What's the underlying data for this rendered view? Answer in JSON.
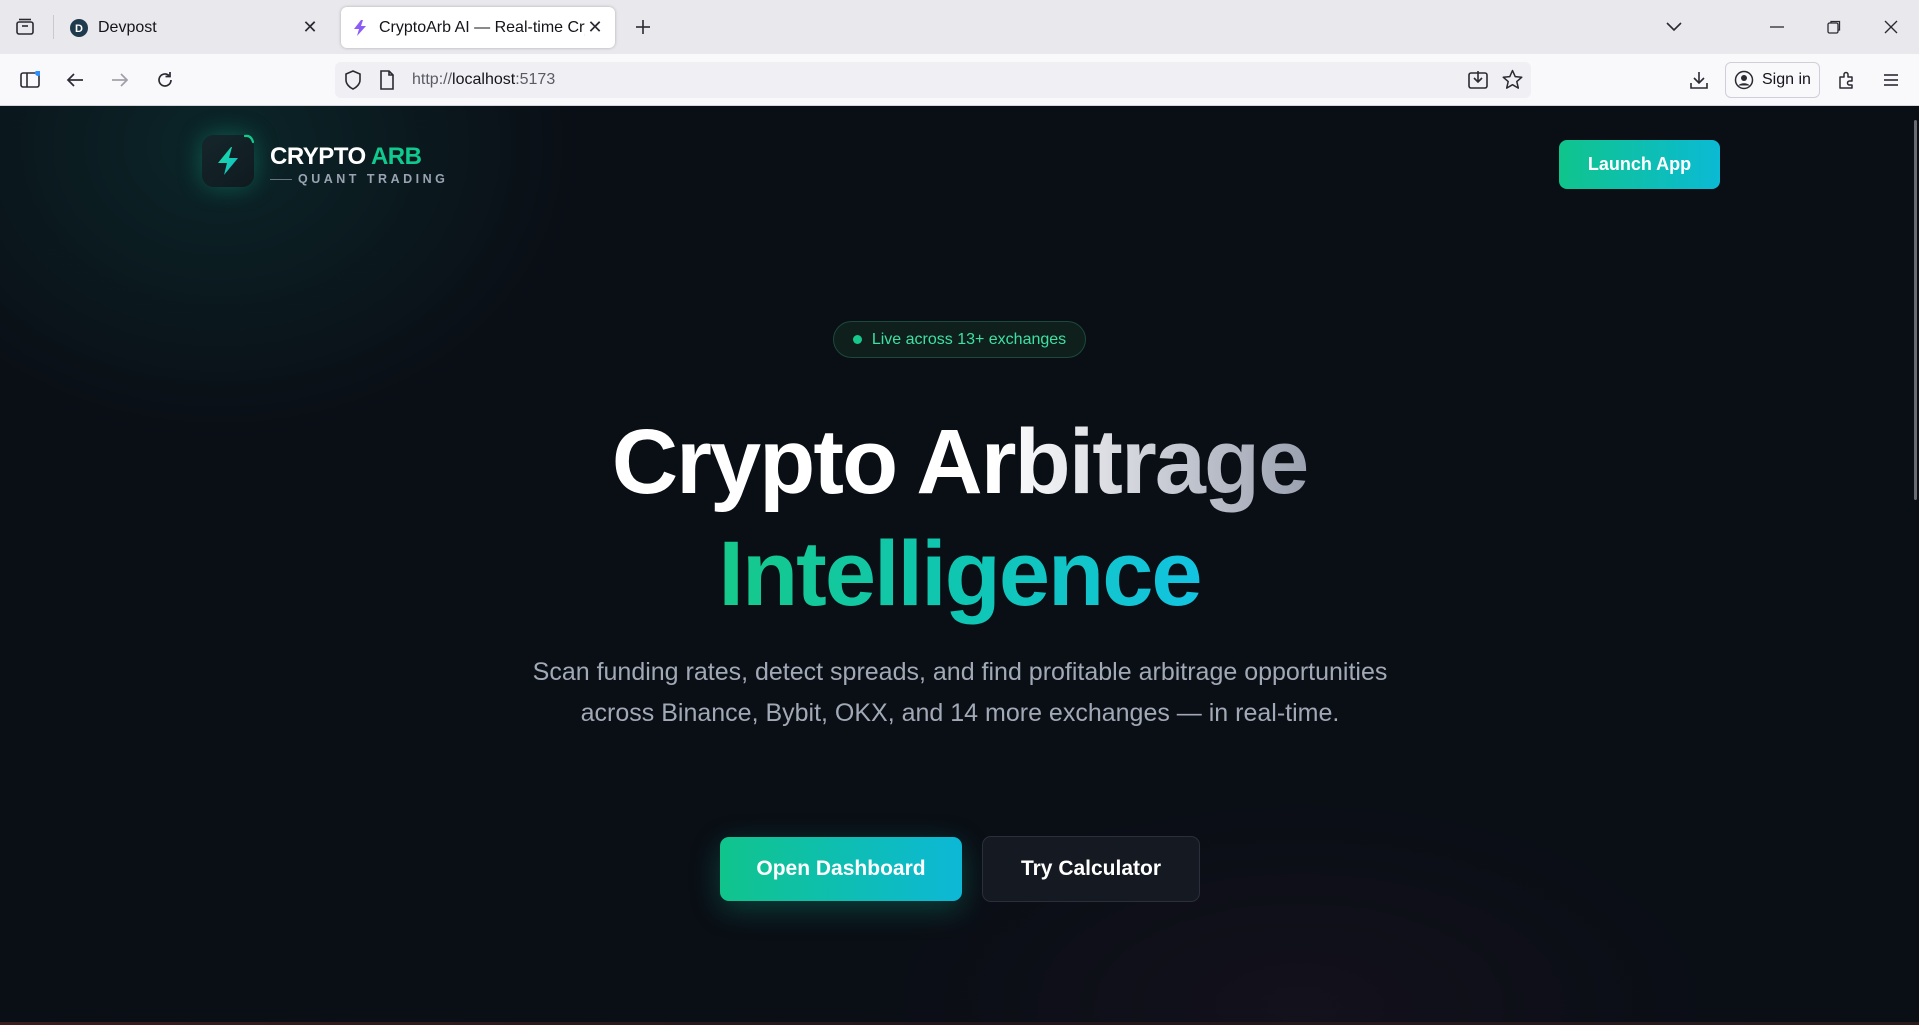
{
  "browser": {
    "tabs": [
      {
        "title": "Devpost",
        "active": false
      },
      {
        "title": "CryptoArb AI — Real-time Crypto",
        "active": true
      }
    ],
    "url": {
      "scheme": "http://",
      "host": "localhost",
      "port": ":5173"
    },
    "signin_label": "Sign in"
  },
  "header": {
    "brand_primary": "CRYPTO",
    "brand_accent": "ARB",
    "brand_sub": "QUANT TRADING",
    "launch_label": "Launch App"
  },
  "hero": {
    "badge": "Live across 13+ exchanges",
    "title_line1": "Crypto Arbitrage",
    "title_line2": "Intelligence",
    "subtitle": "Scan funding rates, detect spreads, and find profitable arbitrage opportunities across Binance, Bybit, OKX, and 14 more exchanges — in real-time.",
    "primary_cta": "Open Dashboard",
    "secondary_cta": "Try Calculator"
  },
  "colors": {
    "accent_green": "#10c48c",
    "accent_cyan": "#0bbad4",
    "background": "#0a0e15"
  }
}
